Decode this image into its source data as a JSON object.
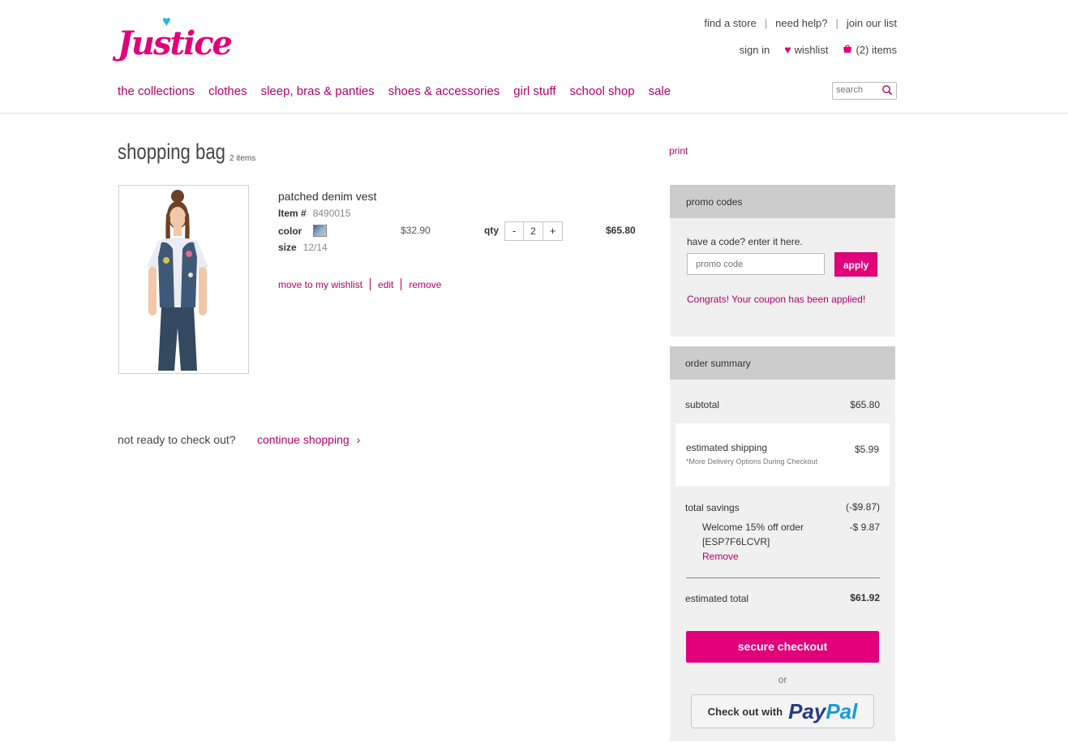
{
  "brand": {
    "logo_text": "Justice",
    "accent": "#e1007a",
    "accent_dark": "#b0006a"
  },
  "utility": {
    "find_store": "find a store",
    "need_help": "need help?",
    "join_list": "join our list",
    "sign_in": "sign in",
    "wishlist": "wishlist",
    "bag": "(2) items",
    "separator": "|"
  },
  "nav": {
    "items": [
      "the collections",
      "clothes",
      "sleep, bras & panties",
      "shoes & accessories",
      "girl stuff",
      "school shop",
      "sale"
    ]
  },
  "search": {
    "placeholder": "search"
  },
  "bag": {
    "title": "shopping bag",
    "count": "2 items",
    "print": "print"
  },
  "item": {
    "name": "patched denim vest",
    "item_label": "Item #",
    "item_number": "8490015",
    "color_label": "color",
    "size_label": "size",
    "size_value": "12/14",
    "unit_price": "$32.90",
    "qty_label": "qty",
    "qty_minus": "-",
    "qty_value": "2",
    "qty_plus": "+",
    "line_total": "$65.80",
    "actions": {
      "wishlist": "move to my wishlist",
      "edit": "edit",
      "remove": "remove"
    }
  },
  "continue": {
    "prompt": "not ready to check out?",
    "link": "continue shopping",
    "chevron": "›"
  },
  "promo": {
    "header": "promo codes",
    "prompt": "have a code? enter it here.",
    "placeholder": "promo code",
    "apply": "apply",
    "success": "Congrats! Your coupon has been applied!"
  },
  "summary": {
    "header": "order summary",
    "subtotal_label": "subtotal",
    "subtotal_value": "$65.80",
    "shipping_label": "estimated shipping",
    "shipping_value": "$5.99",
    "shipping_note": "*More Delivery Options During Checkout",
    "savings_label": "total savings",
    "savings_value": "(-$9.87)",
    "discount_label": "Welcome 15% off order",
    "discount_code": "[ESP7F6LCVR]",
    "discount_value": "-$ 9.87",
    "discount_remove": "Remove",
    "total_label": "estimated total",
    "total_value": "$61.92",
    "checkout": "secure checkout",
    "or": "or",
    "paypal_lead": "Check out with",
    "paypal_a": "Pay",
    "paypal_b": "Pal"
  }
}
